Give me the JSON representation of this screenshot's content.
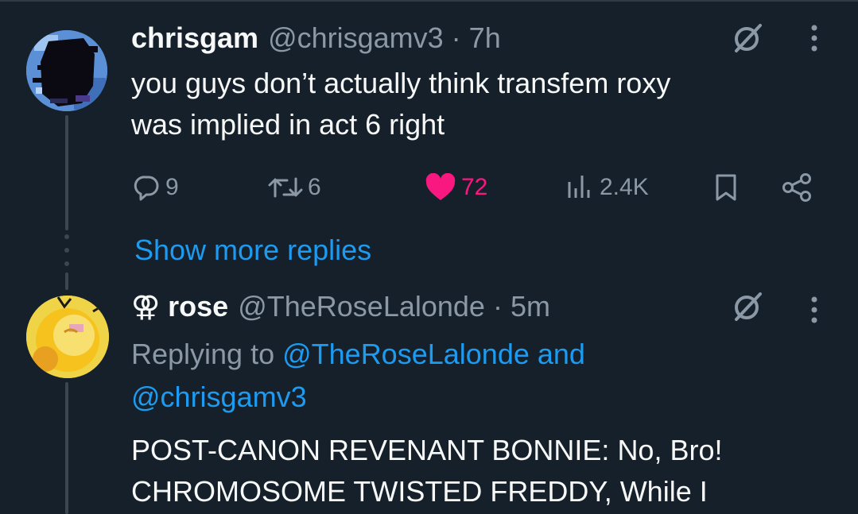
{
  "tweet1": {
    "name": "chrisgam",
    "handle": "@chrisgamv3 · 7h",
    "text_line1": "you guys don’t actually think transfem roxy",
    "text_line2": "was implied in act 6 right",
    "actions": {
      "replies": "9",
      "retweets": "6",
      "likes": "72",
      "views": "2.4K"
    }
  },
  "show_more_replies": "Show more replies",
  "tweet2": {
    "name": "⚢ rose",
    "handle": "@TheRoseLalonde · 5m",
    "replying_prefix": "Replying to ",
    "replying_user1": "@TheRoseLalonde",
    "replying_and": " and",
    "replying_user2": "@chrisgamv3",
    "text_line1": "POST-CANON REVENANT BONNIE: No, Bro!",
    "text_line2": "CHROMOSOME TWISTED FREDDY, While I"
  },
  "colors": {
    "background": "#15202b",
    "secondary_text": "#8b98a5",
    "accent": "#1d9bf0",
    "like": "#f91880"
  },
  "icons": [
    "grok-slash-icon",
    "more-vertical-icon",
    "reply-icon",
    "retweet-icon",
    "heart-icon",
    "views-icon",
    "bookmark-icon",
    "share-icon"
  ]
}
